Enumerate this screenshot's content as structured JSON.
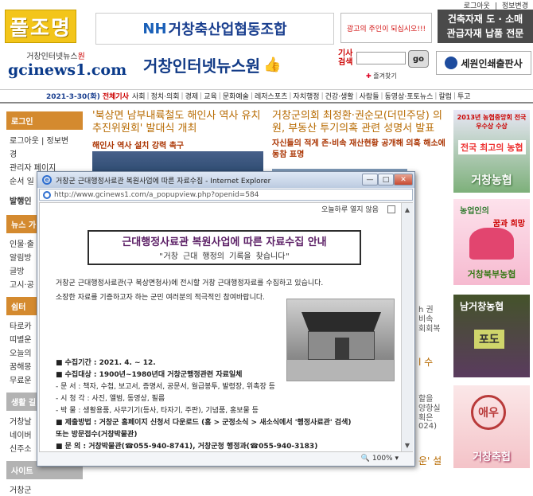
{
  "top": {
    "links": [
      "로그아웃",
      "정보변경"
    ]
  },
  "banners": {
    "pulchomyeong": "풀조명",
    "nh_prefix": "NH",
    "nh_rest": "거창축산업협동조합",
    "ad": "광고의 주인이 되십시오!!!",
    "building_line1": "건축자재 도 · 소매",
    "building_line2": "관급자재 납품 전문",
    "print": "세원인쇄출판사"
  },
  "logo": {
    "small_a": "거창인터넷뉴스",
    "small_b": "원",
    "big": "gcinews1.com"
  },
  "site_title": "거창인터넷뉴스원",
  "search": {
    "label": "기사 검색",
    "go": "go",
    "favorite": "즐겨찾기"
  },
  "nav": {
    "date": "2021-3-30(화)",
    "all": "전체기사",
    "items": [
      "사회",
      "정치·의회",
      "경제",
      "교육",
      "문화예술",
      "레저스포츠",
      "자치행정",
      "건강·생활",
      "사람들",
      "동영상·포토뉴스",
      "칼럼",
      "투고"
    ]
  },
  "sidebar": {
    "login_head": "로그인",
    "login_items": [
      "로그아웃 | 정보변",
      "경",
      "관리자 페이지",
      "순서 일"
    ],
    "label_bal": "발행인",
    "news_head": "뉴스 가",
    "news_items": [
      "인물·출",
      "알림방",
      "글방",
      "고시·공"
    ],
    "space_head": "쉼터",
    "space_items": [
      "타로카",
      "띠별운",
      "오늘의",
      "꿈해몽",
      "무료운"
    ],
    "life_head": "생활 길",
    "life_items": [
      "거창날",
      "네이버",
      "신주소"
    ],
    "site_head": "사이트",
    "site_items": [
      "거창군"
    ]
  },
  "news": {
    "n1_title": "'북상면 남부내륙철도 해인사 역사 유치 추진위원회' 발대식 개최",
    "n1_sub": "해인사 역사 설치 강력 촉구",
    "n2_title": "거창군의회 최정환·권순모(더민주당) 의원, 부동산 투기의혹 관련 성명서 발표",
    "n2_sub": "자신들의 적게 존·비속 재산현황 공개해 의혹 해소에 동참 표명"
  },
  "right_banners": {
    "r1_top": "2013년 농협중앙회 전국 우수상 수상",
    "r1_mid": "전국 최고의 농협",
    "r1_bottom": "거창농협",
    "r2_t1": "농업인의",
    "r2_t2": "꿈과 희망",
    "r2_bottom": "거창북부농협",
    "r3_t": "남거창농협",
    "r3_bottom": "포도",
    "r4_logo": "애우",
    "r4_bottom": "거창축협"
  },
  "fragments": {
    "f1": "h 권",
    "f2": "비속",
    "f3": "회회복",
    "f4": "l 수",
    "f5": "할을",
    "f6": "양항실",
    "f7": "획은",
    "f8": "024)",
    "f9": "운' 설"
  },
  "popup": {
    "title": "거창군 근대행정사료관 복원사업에 따른 자료수집 - Internet Explorer",
    "address": "http://www.gcinews1.com/a_popupview.php?openid=584",
    "noshow": "오늘하루 열지 않음",
    "notice_title": "근대행정사료관 복원사업에 따른 자료수집 안내",
    "notice_sub": "\"거창 근대 행정의 기록을 찾습니다\"",
    "intro_1": "거창군 근대행정사료관(구 북상면청사)에 전시할 거창 근대행정자료를 수집하고 있습니다.",
    "intro_2": "소장한 자료를 기증하고자 하는 군민 여러분의 적극적인 참여바랍니다.",
    "period": "■ 수집기간 : 2021. 4. ~ 12.",
    "target": "■ 수집대상 : 1900년~1980년대 거창군행정관련 자료일체",
    "doc": "  - 문    서 : 책자, 수첩, 보고서, 증명서, 공문서, 월급봉투, 발령장, 위촉장 등",
    "av": "  - 시 청 각 : 사진, 앨범, 동영상, 필름",
    "etc": "  - 박    물 : 생활용품, 사무기기(등사, 타자기, 주판), 기념품, 홍보물 등",
    "submit": "■ 제출방법 : 거창군 홈페이지 신청서 다운로드  (홈 > 군정소식 > 새소식에서 '행정사료관' 검색)",
    "submit2": "               또는 방문접수(거창박물관)",
    "contact": "■ 문    의 : 거창박물관(☎055-940-8741), 거창군청 행정과(☎055-940-3183)",
    "zoom": "100%"
  }
}
